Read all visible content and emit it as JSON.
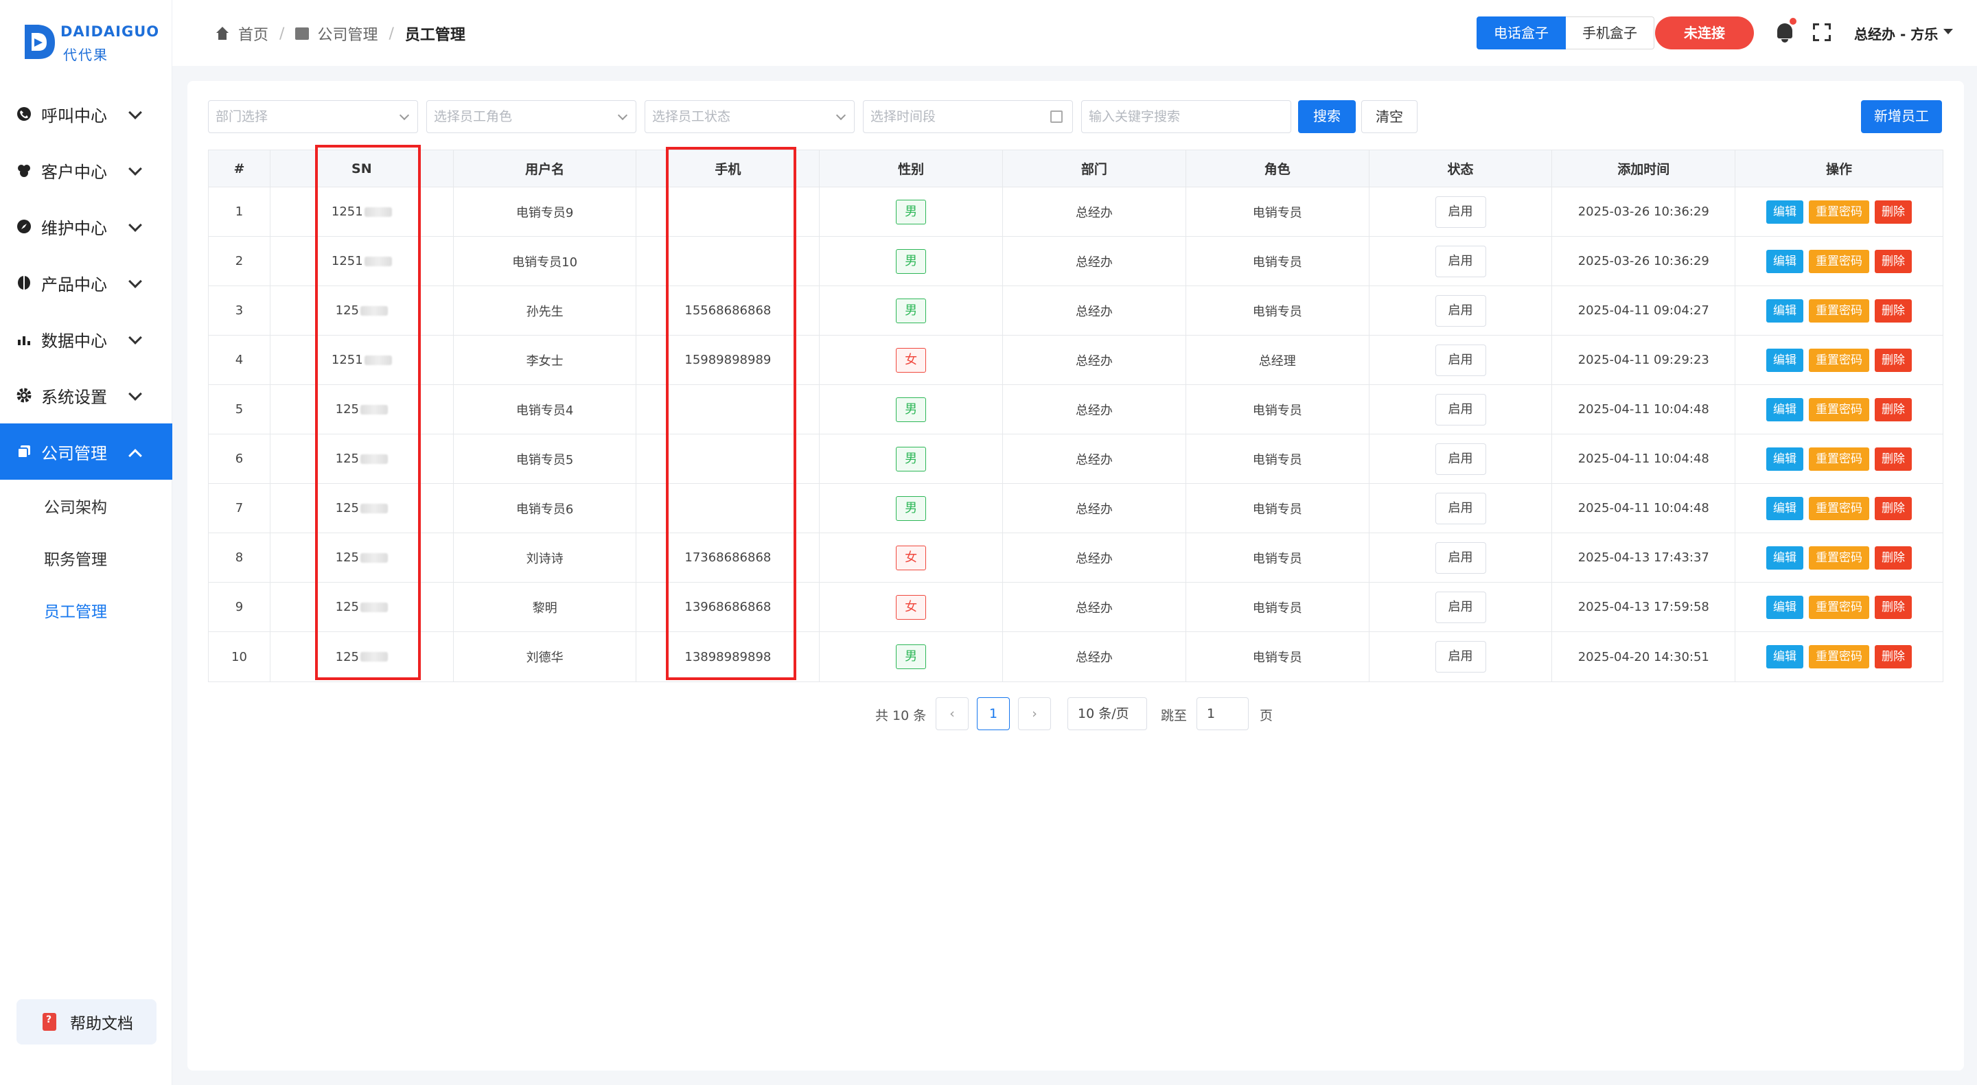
{
  "brand": {
    "name_en": "DAIDAIGUO",
    "name_cn": "代代果",
    "accent": "#1677ee"
  },
  "sidebar": {
    "items": [
      {
        "label": "呼叫中心",
        "icon": "phone-icon"
      },
      {
        "label": "客户中心",
        "icon": "users-icon"
      },
      {
        "label": "维护中心",
        "icon": "compass-icon"
      },
      {
        "label": "产品中心",
        "icon": "box-icon"
      },
      {
        "label": "数据中心",
        "icon": "bar-chart-icon"
      },
      {
        "label": "系统设置",
        "icon": "gear-icon"
      },
      {
        "label": "公司管理",
        "icon": "copy-icon",
        "active": true
      }
    ],
    "sub_items": [
      {
        "label": "公司架构"
      },
      {
        "label": "职务管理"
      },
      {
        "label": "员工管理",
        "active": true
      }
    ],
    "help": "帮助文档"
  },
  "header": {
    "breadcrumb": [
      "首页",
      "公司管理",
      "员工管理"
    ],
    "seg": [
      "电话盒子",
      "手机盒子"
    ],
    "disconnect": "未连接",
    "user": "总经办 - 方乐"
  },
  "filters": {
    "dept": "部门选择",
    "role": "选择员工角色",
    "status": "选择员工状态",
    "time": "选择时间段",
    "keyword": "输入关键字搜索",
    "search": "搜索",
    "clear": "清空",
    "add": "新增员工"
  },
  "table": {
    "columns": [
      "#",
      "SN",
      "用户名",
      "手机",
      "性别",
      "部门",
      "角色",
      "状态",
      "添加时间",
      "操作"
    ],
    "ops": {
      "edit": "编辑",
      "reset": "重置密码",
      "delete": "删除"
    },
    "rows": [
      {
        "no": "1",
        "sn": "1251",
        "username": "电销专员9",
        "phone": "",
        "gender": "男",
        "dept": "总经办",
        "role": "电销专员",
        "status": "启用",
        "time": "2025-03-26 10:36:29"
      },
      {
        "no": "2",
        "sn": "1251",
        "username": "电销专员10",
        "phone": "",
        "gender": "男",
        "dept": "总经办",
        "role": "电销专员",
        "status": "启用",
        "time": "2025-03-26 10:36:29"
      },
      {
        "no": "3",
        "sn": "125",
        "username": "孙先生",
        "phone": "15568686868",
        "gender": "男",
        "dept": "总经办",
        "role": "电销专员",
        "status": "启用",
        "time": "2025-04-11 09:04:27"
      },
      {
        "no": "4",
        "sn": "1251",
        "username": "李女士",
        "phone": "15989898989",
        "gender": "女",
        "dept": "总经办",
        "role": "总经理",
        "status": "启用",
        "time": "2025-04-11 09:29:23"
      },
      {
        "no": "5",
        "sn": "125",
        "username": "电销专员4",
        "phone": "",
        "gender": "男",
        "dept": "总经办",
        "role": "电销专员",
        "status": "启用",
        "time": "2025-04-11 10:04:48"
      },
      {
        "no": "6",
        "sn": "125",
        "username": "电销专员5",
        "phone": "",
        "gender": "男",
        "dept": "总经办",
        "role": "电销专员",
        "status": "启用",
        "time": "2025-04-11 10:04:48"
      },
      {
        "no": "7",
        "sn": "125",
        "username": "电销专员6",
        "phone": "",
        "gender": "男",
        "dept": "总经办",
        "role": "电销专员",
        "status": "启用",
        "time": "2025-04-11 10:04:48"
      },
      {
        "no": "8",
        "sn": "125",
        "username": "刘诗诗",
        "phone": "17368686868",
        "gender": "女",
        "dept": "总经办",
        "role": "电销专员",
        "status": "启用",
        "time": "2025-04-13 17:43:37"
      },
      {
        "no": "9",
        "sn": "125",
        "username": "黎明",
        "phone": "13968686868",
        "gender": "女",
        "dept": "总经办",
        "role": "电销专员",
        "status": "启用",
        "time": "2025-04-13 17:59:58"
      },
      {
        "no": "10",
        "sn": "125",
        "username": "刘德华",
        "phone": "13898989898",
        "gender": "男",
        "dept": "总经办",
        "role": "电销专员",
        "status": "启用",
        "time": "2025-04-20 14:30:51"
      }
    ]
  },
  "pagination": {
    "total": "共 10 条",
    "prev": "‹",
    "current": "1",
    "next": "›",
    "page_size": "10 条/页",
    "jump_label": "跳至",
    "jump_value": "1",
    "page_word": "页"
  }
}
